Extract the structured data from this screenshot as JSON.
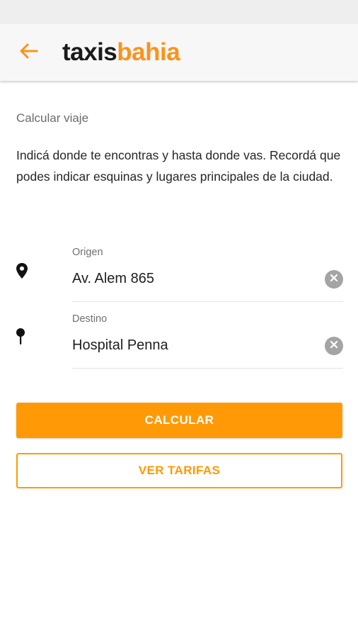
{
  "colors": {
    "accent": "#ff9a06",
    "logo_orange": "#f7941d",
    "logo_dark": "#1a1a1a"
  },
  "header": {
    "back_icon": "arrow-left-icon",
    "logo_part1": "taxis",
    "logo_part2": "bahia"
  },
  "main": {
    "section_title": "Calcular viaje",
    "intro_text": "Indicá donde te encontras y hasta donde vas. Recordá que podes indicar esquinas y lugares principales de la ciudad."
  },
  "form": {
    "origin": {
      "icon": "map-pin-icon",
      "label": "Origen",
      "value": "Av. Alem 865",
      "clear_icon": "clear-icon"
    },
    "destination": {
      "icon": "pushpin-icon",
      "label": "Destino",
      "value": "Hospital Penna",
      "clear_icon": "clear-icon"
    }
  },
  "actions": {
    "calculate_label": "CALCULAR",
    "rates_label": "VER TARIFAS"
  }
}
